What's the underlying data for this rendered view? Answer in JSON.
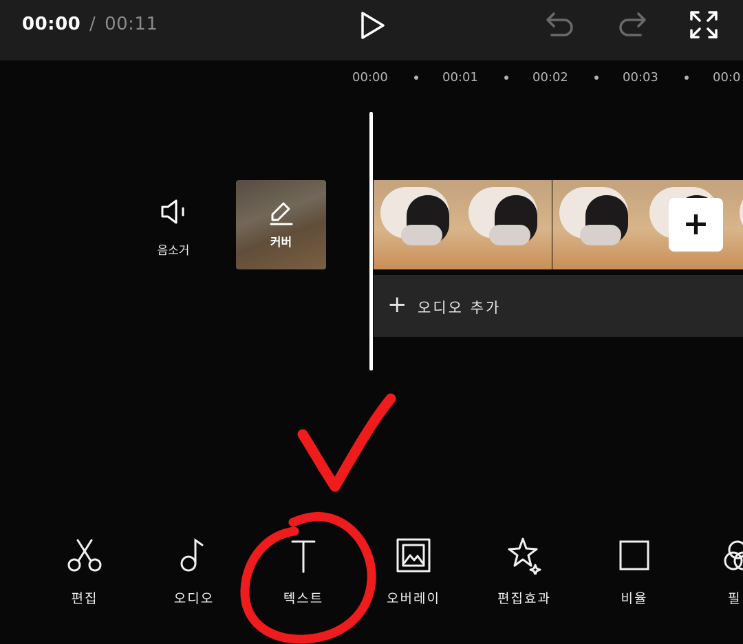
{
  "header": {
    "current_time": "00:00",
    "separator": "/",
    "total_time": "00:11"
  },
  "ruler": {
    "ticks": [
      "00:00",
      "00:01",
      "00:02",
      "00:03",
      "00:0"
    ]
  },
  "timeline": {
    "mute_label": "음소거",
    "cover_label": "커버",
    "audio_add_plus": "+",
    "audio_add_label": "오디오 추가",
    "add_clip_symbol": "+"
  },
  "toolbar": {
    "items": [
      {
        "label": "편집",
        "icon": "scissors-icon"
      },
      {
        "label": "오디오",
        "icon": "music-note-icon"
      },
      {
        "label": "텍스트",
        "icon": "text-icon"
      },
      {
        "label": "오버레이",
        "icon": "overlay-image-icon"
      },
      {
        "label": "편집효과",
        "icon": "sparkle-star-icon"
      },
      {
        "label": "비율",
        "icon": "square-ratio-icon"
      },
      {
        "label": "필",
        "icon": "filter-icon"
      }
    ]
  },
  "colors": {
    "background": "#080808",
    "topbar": "#1d1d1d",
    "audio_track": "#262626",
    "annotation_red": "#ee1c1c",
    "muted_text": "#8a8a8a"
  }
}
